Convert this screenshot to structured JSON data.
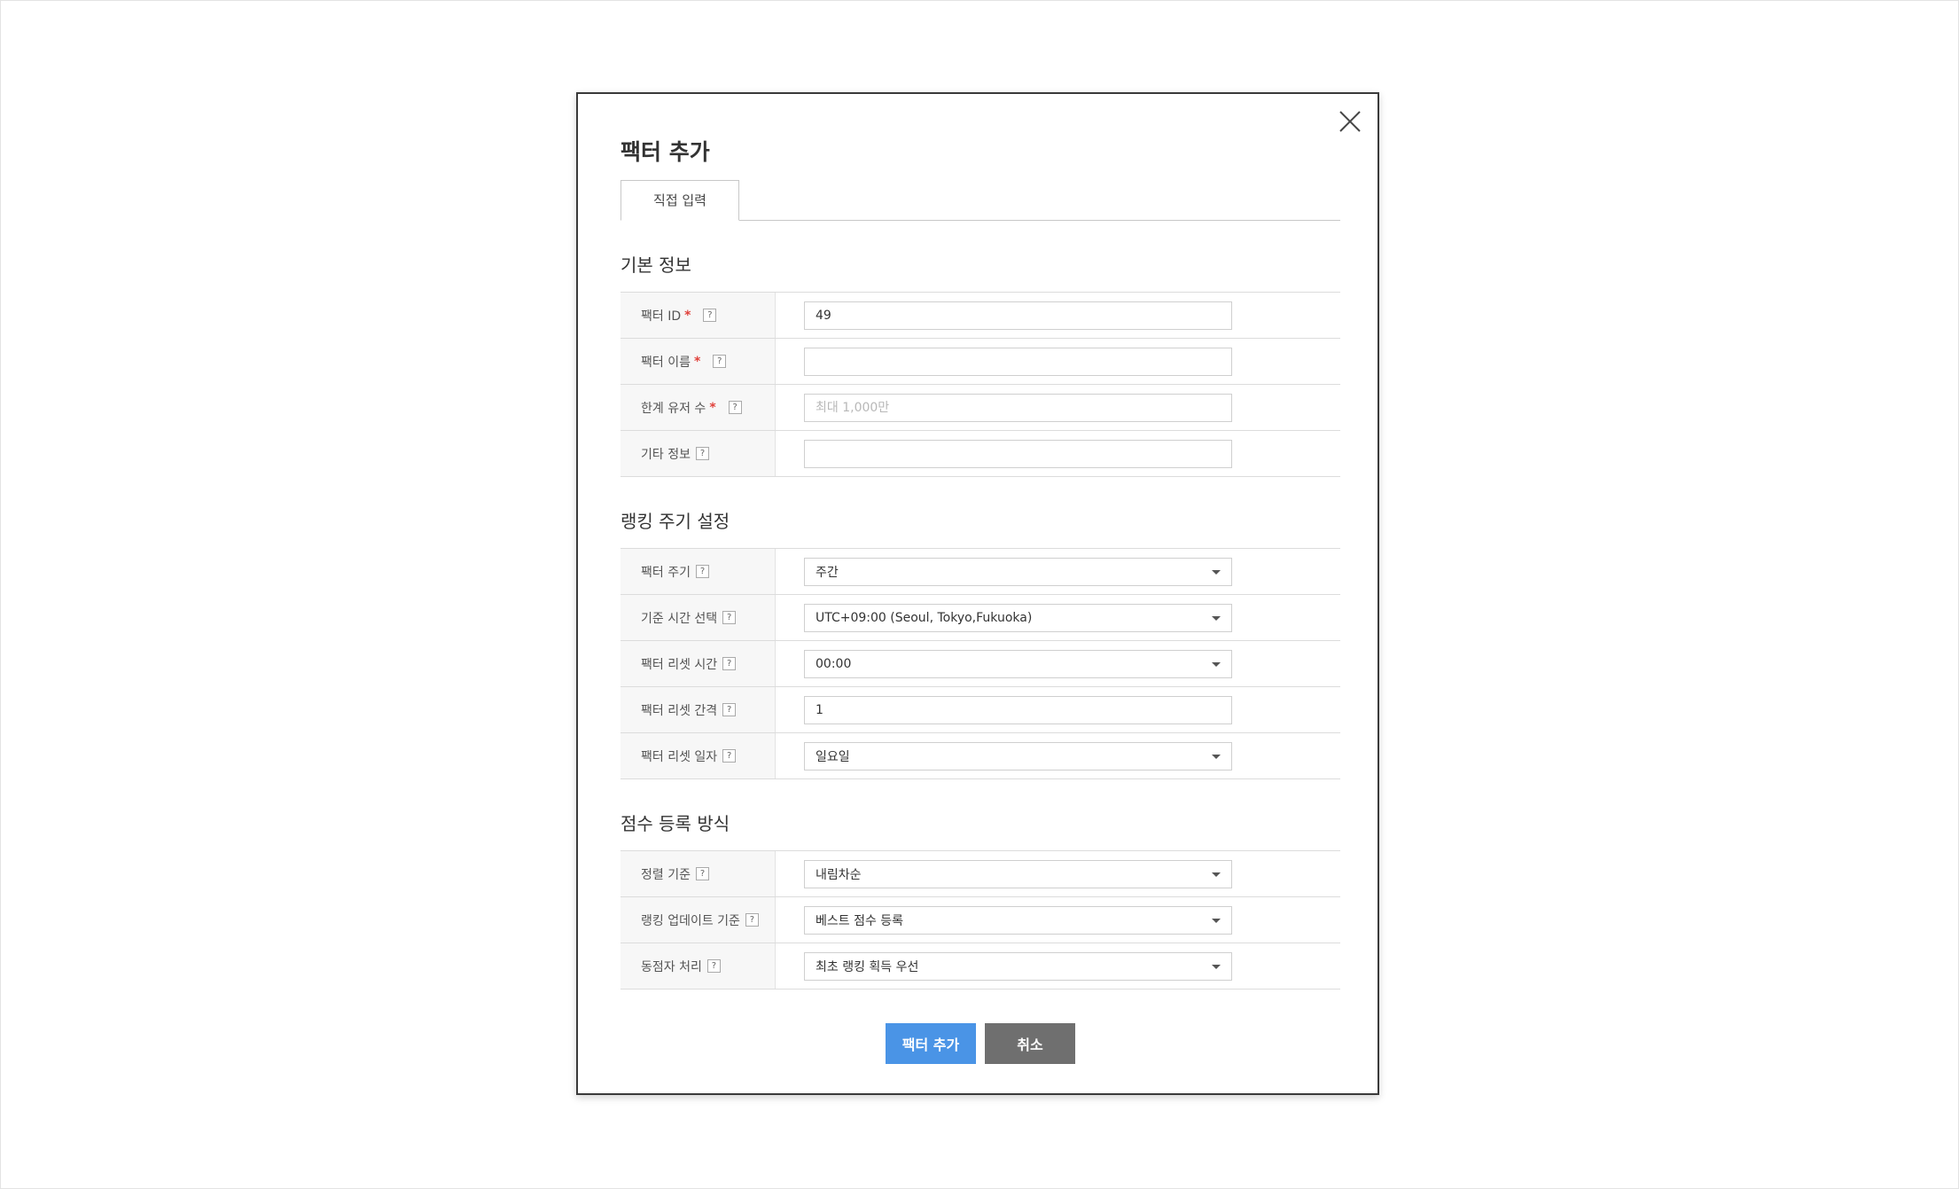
{
  "modal": {
    "title": "팩터 추가",
    "close_icon": "close-icon",
    "tabs": [
      {
        "label": "직접 입력",
        "active": true
      }
    ]
  },
  "sections": [
    {
      "title": "기본 정보",
      "rows": [
        {
          "label": "팩터 ID",
          "required": true,
          "type": "input",
          "value": "49",
          "placeholder": ""
        },
        {
          "label": "팩터 이름",
          "required": true,
          "type": "input",
          "value": "",
          "placeholder": ""
        },
        {
          "label": "한계 유저 수",
          "required": true,
          "type": "input",
          "value": "",
          "placeholder": "최대 1,000만"
        },
        {
          "label": "기타 정보",
          "required": false,
          "type": "input",
          "value": "",
          "placeholder": ""
        }
      ]
    },
    {
      "title": "랭킹 주기 설정",
      "rows": [
        {
          "label": "팩터 주기",
          "required": false,
          "type": "select",
          "value": "주간"
        },
        {
          "label": "기준 시간 선택",
          "required": false,
          "type": "select",
          "value": "UTC+09:00 (Seoul, Tokyo,Fukuoka)"
        },
        {
          "label": "팩터 리셋 시간",
          "required": false,
          "type": "select",
          "value": "00:00"
        },
        {
          "label": "팩터 리셋 간격",
          "required": false,
          "type": "input",
          "value": "1",
          "placeholder": ""
        },
        {
          "label": "팩터 리셋 일자",
          "required": false,
          "type": "select",
          "value": "일요일"
        }
      ]
    },
    {
      "title": "점수 등록 방식",
      "rows": [
        {
          "label": "정렬 기준",
          "required": false,
          "type": "select",
          "value": "내림차순"
        },
        {
          "label": "랭킹 업데이트 기준",
          "required": false,
          "type": "select",
          "value": "베스트 점수 등록"
        },
        {
          "label": "동점자 처리",
          "required": false,
          "type": "select",
          "value": "최초 랭킹 획득 우선"
        }
      ]
    }
  ],
  "help_glyph": "?",
  "required_mark": "*",
  "buttons": {
    "submit": "팩터 추가",
    "cancel": "취소"
  },
  "colors": {
    "primary": "#4a94e6",
    "secondary": "#6f6f6f",
    "required": "#e0403a"
  }
}
